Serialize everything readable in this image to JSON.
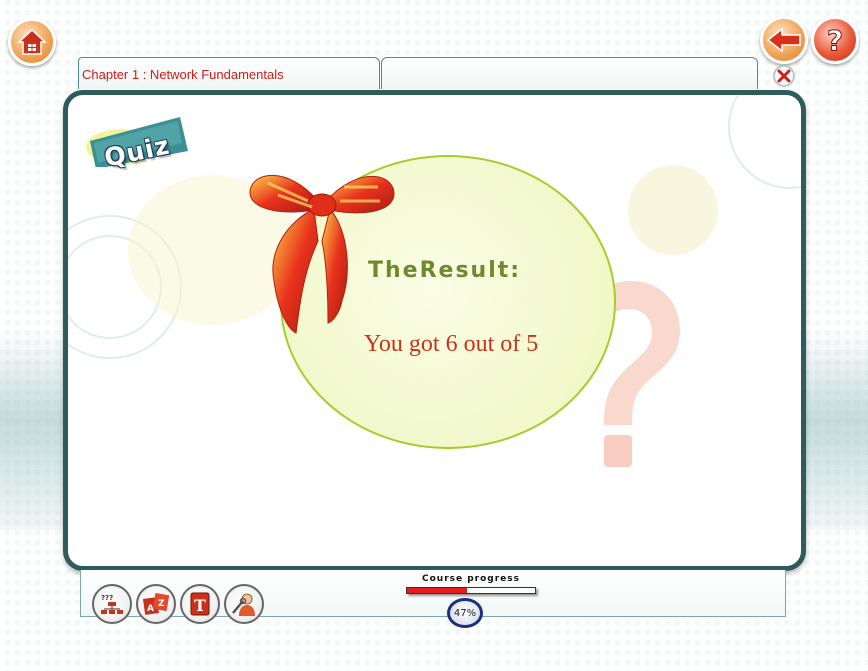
{
  "header": {
    "chapter_title": "Chapter 1 : Network Fundamentals",
    "home_icon": "home-icon",
    "back_icon": "back-arrow-icon",
    "help_icon": "help-icon",
    "close_icon": "close-icon"
  },
  "quiz": {
    "badge_label": "Quiz",
    "result_title": "TheResult:",
    "result_text": "You got 6 out of 5"
  },
  "footer": {
    "tools": [
      {
        "icon": "course-map-icon"
      },
      {
        "icon": "glossary-icon"
      },
      {
        "icon": "text-icon"
      },
      {
        "icon": "support-icon"
      }
    ],
    "progress_label": "Course progress",
    "progress_value": "47%",
    "progress_fraction": 0.47
  },
  "colors": {
    "accent_red": "#d11a1a",
    "panel_border": "#2f5b5d",
    "result_green": "#6e8a2c",
    "ellipse_border": "#a6cc2a"
  }
}
